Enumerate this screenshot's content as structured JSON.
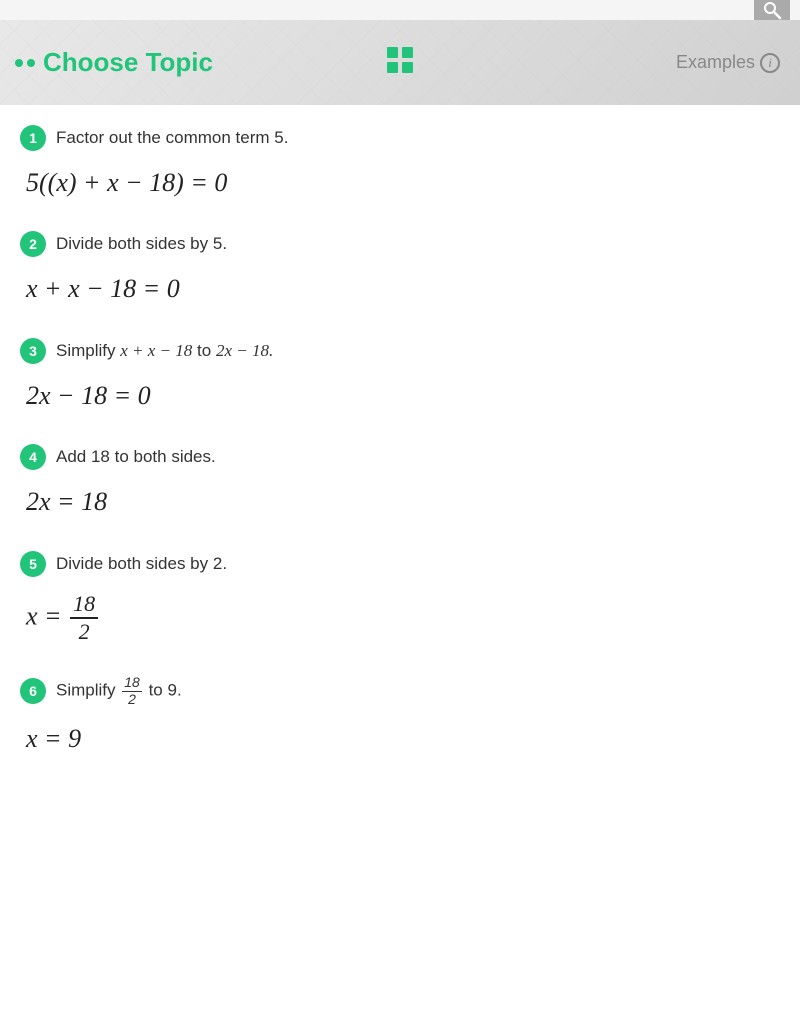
{
  "header": {
    "dots": [
      "dot1",
      "dot2"
    ],
    "choose_topic_label": "Choose Topic",
    "grid_icon_label": "grid",
    "examples_label": "Examples",
    "examples_info": "i"
  },
  "steps": [
    {
      "number": "1",
      "description": "Factor out the common term 5.",
      "math_html": "step1_math"
    },
    {
      "number": "2",
      "description": "Divide both sides by 5.",
      "math_html": "step2_math"
    },
    {
      "number": "3",
      "description_prefix": "Simplify",
      "description_expr1": "x + x − 18",
      "description_middle": "to",
      "description_expr2": "2x − 18.",
      "math_html": "step3_math"
    },
    {
      "number": "4",
      "description": "Add 18 to both sides.",
      "math_html": "step4_math"
    },
    {
      "number": "5",
      "description": "Divide both sides by 2.",
      "math_html": "step5_math"
    },
    {
      "number": "6",
      "description_prefix": "Simplify",
      "description_middle": "to",
      "description_expr2": "9.",
      "math_html": "step6_math"
    }
  ],
  "colors": {
    "accent": "#22c47a",
    "text_dark": "#222",
    "text_muted": "#888"
  }
}
